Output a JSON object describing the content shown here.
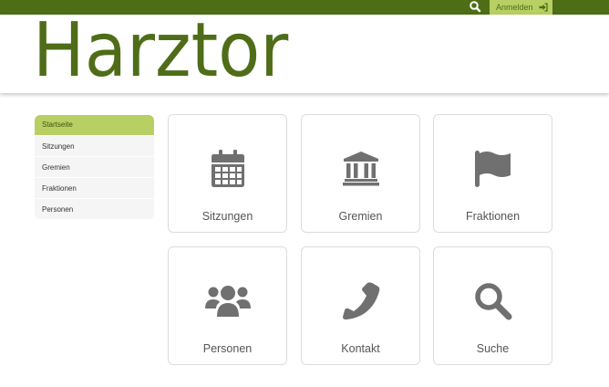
{
  "topbar": {
    "login_label": "Anmelden"
  },
  "header": {
    "logo_text": "Harztor"
  },
  "sidebar": {
    "items": [
      {
        "label": "Startseite",
        "active": true
      },
      {
        "label": "Sitzungen"
      },
      {
        "label": "Gremien"
      },
      {
        "label": "Fraktionen"
      },
      {
        "label": "Personen"
      }
    ]
  },
  "tiles": [
    {
      "label": "Sitzungen",
      "icon": "calendar-icon"
    },
    {
      "label": "Gremien",
      "icon": "institution-icon"
    },
    {
      "label": "Fraktionen",
      "icon": "flag-icon"
    },
    {
      "label": "Personen",
      "icon": "users-icon"
    },
    {
      "label": "Kontakt",
      "icon": "phone-icon"
    },
    {
      "label": "Suche",
      "icon": "search-icon"
    }
  ],
  "colors": {
    "brand_dark": "#4d6e14",
    "brand_light": "#b8cf63",
    "icon_gray": "#707070"
  }
}
